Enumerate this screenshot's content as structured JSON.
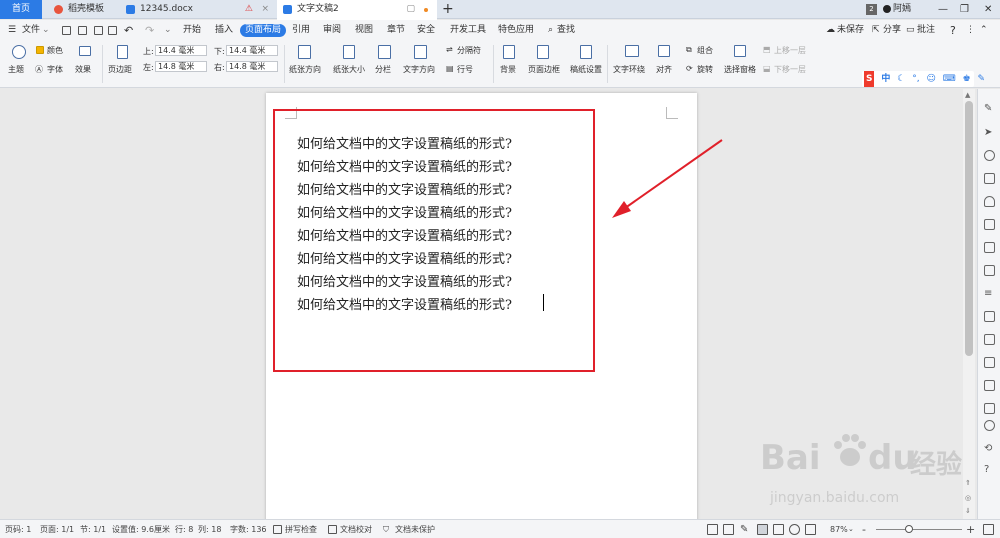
{
  "tabs": {
    "home": "首页",
    "items": [
      {
        "label": "稻壳模板"
      },
      {
        "label": "12345.docx"
      },
      {
        "label": "文字文稿2"
      }
    ],
    "new_tab": "+"
  },
  "titlebar": {
    "badge": "2",
    "user": "阿嫣"
  },
  "menubar": {
    "file": "文件",
    "items": [
      "开始",
      "插入",
      "页面布局",
      "引用",
      "审阅",
      "视图",
      "章节",
      "安全",
      "开发工具",
      "特色应用"
    ],
    "search": "查找",
    "unsaved": "未保存",
    "share": "分享",
    "comment": "批注",
    "help": "?"
  },
  "ribbon": {
    "theme": "主题",
    "colors": "颜色",
    "font": "字体",
    "effects": "效果",
    "margins": "页边距",
    "top_label": "上:",
    "top_value": "14.4 毫米",
    "bottom_label": "下:",
    "bottom_value": "14.4 毫米",
    "left_label": "左:",
    "left_value": "14.8 毫米",
    "right_label": "右:",
    "right_value": "14.8 毫米",
    "orientation": "纸张方向",
    "size": "纸张大小",
    "columns": "分栏",
    "text_direction": "文字方向",
    "breaks": "分隔符",
    "line_numbers": "行号",
    "background": "背景",
    "page_border": "页面边框",
    "paper_settings": "稿纸设置",
    "wrap_text": "文字环绕",
    "align": "对齐",
    "group": "组合",
    "rotate": "旋转",
    "selection_pane": "选择窗格",
    "bring_forward": "上移一层",
    "send_backward": "下移一层"
  },
  "ime": {
    "logo": "S",
    "mode": "中"
  },
  "document": {
    "lines": [
      "如何给文档中的文字设置稿纸的形式?",
      "如何给文档中的文字设置稿纸的形式?",
      "如何给文档中的文字设置稿纸的形式?",
      "如何给文档中的文字设置稿纸的形式?",
      "如何给文档中的文字设置稿纸的形式?",
      "如何给文档中的文字设置稿纸的形式?",
      "如何给文档中的文字设置稿纸的形式?",
      "如何给文档中的文字设置稿纸的形式?"
    ]
  },
  "watermark": {
    "brand": "Bai",
    "brand2": "du",
    "cn": "经验",
    "url": "jingyan.baidu.com"
  },
  "statusbar": {
    "page": "页码: 1",
    "pages": "页面: 1/1",
    "section": "节: 1/1",
    "position": "设置值: 9.6厘米",
    "row": "行: 8",
    "col": "列: 18",
    "words": "字数: 136",
    "spell": "拼写检查",
    "proof": "文档校对",
    "protect": "文档未保护",
    "zoom": "87%",
    "zoom_minus": "-",
    "zoom_plus": "+"
  },
  "colors": {
    "accent": "#2c7be5",
    "highlight_box": "#e0202a",
    "arrow": "#e0202a"
  }
}
